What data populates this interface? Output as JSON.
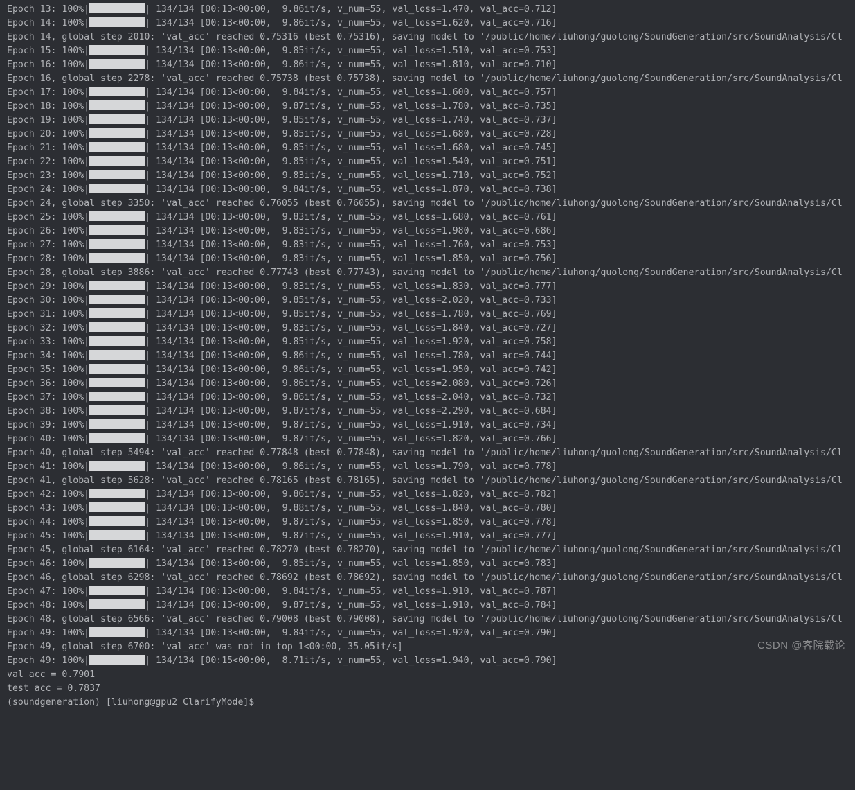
{
  "terminal": {
    "progress_total": "134/134",
    "progress_time": "[00:13<00:00",
    "v_num": "55",
    "save_path": "'/public/home/liuhong/guolong/SoundGeneration/src/SoundAnalysis/Cl",
    "lines": [
      {
        "type": "epoch",
        "epoch": 13,
        "rate": "9.86",
        "val_loss": "1.470",
        "val_acc": "0.712"
      },
      {
        "type": "epoch",
        "epoch": 14,
        "rate": "9.86",
        "val_loss": "1.620",
        "val_acc": "0.716"
      },
      {
        "type": "save",
        "epoch": 14,
        "step": 2010,
        "reached": "0.75316",
        "best": "0.75316"
      },
      {
        "type": "epoch",
        "epoch": 15,
        "rate": "9.85",
        "val_loss": "1.510",
        "val_acc": "0.753"
      },
      {
        "type": "epoch",
        "epoch": 16,
        "rate": "9.86",
        "val_loss": "1.810",
        "val_acc": "0.710"
      },
      {
        "type": "save",
        "epoch": 16,
        "step": 2278,
        "reached": "0.75738",
        "best": "0.75738"
      },
      {
        "type": "epoch",
        "epoch": 17,
        "rate": "9.84",
        "val_loss": "1.600",
        "val_acc": "0.757"
      },
      {
        "type": "epoch",
        "epoch": 18,
        "rate": "9.87",
        "val_loss": "1.780",
        "val_acc": "0.735"
      },
      {
        "type": "epoch",
        "epoch": 19,
        "rate": "9.85",
        "val_loss": "1.740",
        "val_acc": "0.737"
      },
      {
        "type": "epoch",
        "epoch": 20,
        "rate": "9.85",
        "val_loss": "1.680",
        "val_acc": "0.728"
      },
      {
        "type": "epoch",
        "epoch": 21,
        "rate": "9.85",
        "val_loss": "1.680",
        "val_acc": "0.745"
      },
      {
        "type": "epoch",
        "epoch": 22,
        "rate": "9.85",
        "val_loss": "1.540",
        "val_acc": "0.751"
      },
      {
        "type": "epoch",
        "epoch": 23,
        "rate": "9.83",
        "val_loss": "1.710",
        "val_acc": "0.752"
      },
      {
        "type": "epoch",
        "epoch": 24,
        "rate": "9.84",
        "val_loss": "1.870",
        "val_acc": "0.738"
      },
      {
        "type": "save",
        "epoch": 24,
        "step": 3350,
        "reached": "0.76055",
        "best": "0.76055"
      },
      {
        "type": "epoch",
        "epoch": 25,
        "rate": "9.83",
        "val_loss": "1.680",
        "val_acc": "0.761"
      },
      {
        "type": "epoch",
        "epoch": 26,
        "rate": "9.83",
        "val_loss": "1.980",
        "val_acc": "0.686"
      },
      {
        "type": "epoch",
        "epoch": 27,
        "rate": "9.83",
        "val_loss": "1.760",
        "val_acc": "0.753"
      },
      {
        "type": "epoch",
        "epoch": 28,
        "rate": "9.83",
        "val_loss": "1.850",
        "val_acc": "0.756"
      },
      {
        "type": "save",
        "epoch": 28,
        "step": 3886,
        "reached": "0.77743",
        "best": "0.77743"
      },
      {
        "type": "epoch",
        "epoch": 29,
        "rate": "9.83",
        "val_loss": "1.830",
        "val_acc": "0.777"
      },
      {
        "type": "epoch",
        "epoch": 30,
        "rate": "9.85",
        "val_loss": "2.020",
        "val_acc": "0.733"
      },
      {
        "type": "epoch",
        "epoch": 31,
        "rate": "9.85",
        "val_loss": "1.780",
        "val_acc": "0.769"
      },
      {
        "type": "epoch",
        "epoch": 32,
        "rate": "9.83",
        "val_loss": "1.840",
        "val_acc": "0.727"
      },
      {
        "type": "epoch",
        "epoch": 33,
        "rate": "9.85",
        "val_loss": "1.920",
        "val_acc": "0.758"
      },
      {
        "type": "epoch",
        "epoch": 34,
        "rate": "9.86",
        "val_loss": "1.780",
        "val_acc": "0.744"
      },
      {
        "type": "epoch",
        "epoch": 35,
        "rate": "9.86",
        "val_loss": "1.950",
        "val_acc": "0.742"
      },
      {
        "type": "epoch",
        "epoch": 36,
        "rate": "9.86",
        "val_loss": "2.080",
        "val_acc": "0.726"
      },
      {
        "type": "epoch",
        "epoch": 37,
        "rate": "9.86",
        "val_loss": "2.040",
        "val_acc": "0.732"
      },
      {
        "type": "epoch",
        "epoch": 38,
        "rate": "9.87",
        "val_loss": "2.290",
        "val_acc": "0.684"
      },
      {
        "type": "epoch",
        "epoch": 39,
        "rate": "9.87",
        "val_loss": "1.910",
        "val_acc": "0.734"
      },
      {
        "type": "epoch",
        "epoch": 40,
        "rate": "9.87",
        "val_loss": "1.820",
        "val_acc": "0.766"
      },
      {
        "type": "save",
        "epoch": 40,
        "step": 5494,
        "reached": "0.77848",
        "best": "0.77848"
      },
      {
        "type": "epoch",
        "epoch": 41,
        "rate": "9.86",
        "val_loss": "1.790",
        "val_acc": "0.778"
      },
      {
        "type": "save",
        "epoch": 41,
        "step": 5628,
        "reached": "0.78165",
        "best": "0.78165"
      },
      {
        "type": "epoch",
        "epoch": 42,
        "rate": "9.86",
        "val_loss": "1.820",
        "val_acc": "0.782"
      },
      {
        "type": "epoch",
        "epoch": 43,
        "rate": "9.88",
        "val_loss": "1.840",
        "val_acc": "0.780"
      },
      {
        "type": "epoch",
        "epoch": 44,
        "rate": "9.87",
        "val_loss": "1.850",
        "val_acc": "0.778"
      },
      {
        "type": "epoch",
        "epoch": 45,
        "rate": "9.87",
        "val_loss": "1.910",
        "val_acc": "0.777"
      },
      {
        "type": "save",
        "epoch": 45,
        "step": 6164,
        "reached": "0.78270",
        "best": "0.78270"
      },
      {
        "type": "epoch",
        "epoch": 46,
        "rate": "9.85",
        "val_loss": "1.850",
        "val_acc": "0.783"
      },
      {
        "type": "save",
        "epoch": 46,
        "step": 6298,
        "reached": "0.78692",
        "best": "0.78692"
      },
      {
        "type": "epoch",
        "epoch": 47,
        "rate": "9.84",
        "val_loss": "1.910",
        "val_acc": "0.787"
      },
      {
        "type": "epoch",
        "epoch": 48,
        "rate": "9.87",
        "val_loss": "1.910",
        "val_acc": "0.784"
      },
      {
        "type": "save",
        "epoch": 48,
        "step": 6566,
        "reached": "0.79008",
        "best": "0.79008"
      },
      {
        "type": "epoch",
        "epoch": 49,
        "rate": "9.84",
        "val_loss": "1.920",
        "val_acc": "0.790"
      },
      {
        "type": "nottop",
        "epoch": 49,
        "step": 6700,
        "tail": "1<00:00, 35.05it/s]"
      },
      {
        "type": "epoch",
        "epoch": 49,
        "rate": "8.71",
        "val_loss": "1.940",
        "val_acc": "0.790",
        "time": "[00:15<00:00"
      }
    ],
    "summary": {
      "val_acc_label": "val acc = ",
      "val_acc_value": "0.7901",
      "test_acc_label": "test acc = ",
      "test_acc_value": "0.7837"
    },
    "prompt": "(soundgeneration) [liuhong@gpu2 ClarifyMode]$"
  },
  "watermark": "CSDN @客院载论"
}
